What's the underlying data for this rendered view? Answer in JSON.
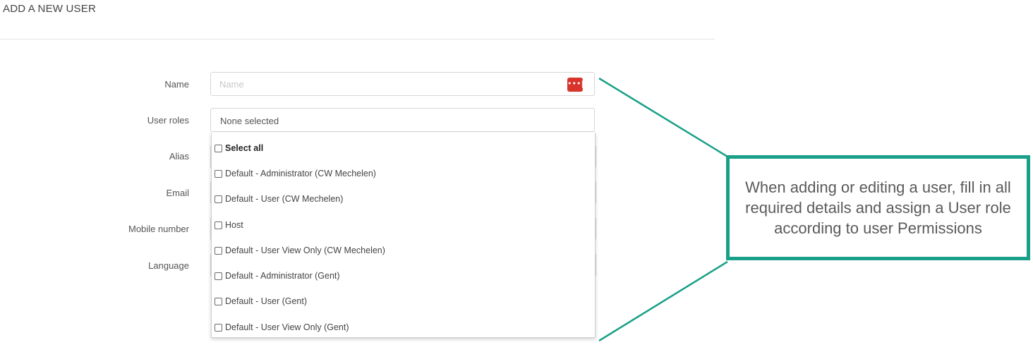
{
  "page": {
    "title": "ADD A NEW USER"
  },
  "form": {
    "name": {
      "label": "Name",
      "placeholder": "Name",
      "password_manager_icon": "password-manager-icon"
    },
    "user_roles": {
      "label": "User roles",
      "value": "None selected"
    },
    "alias": {
      "label": "Alias"
    },
    "email": {
      "label": "Email"
    },
    "mobile": {
      "label": "Mobile number"
    },
    "language": {
      "label": "Language"
    }
  },
  "dropdown": {
    "options": [
      {
        "label": "Select all",
        "checked": false,
        "bold": true
      },
      {
        "label": "Default - Administrator (CW Mechelen)",
        "checked": false
      },
      {
        "label": "Default - User (CW Mechelen)",
        "checked": false
      },
      {
        "label": "Host",
        "checked": false
      },
      {
        "label": "Default - User View Only (CW Mechelen)",
        "checked": false
      },
      {
        "label": "Default - Administrator (Gent)",
        "checked": false
      },
      {
        "label": "Default - User (Gent)",
        "checked": false
      },
      {
        "label": "Default - User View Only (Gent)",
        "checked": false
      }
    ]
  },
  "callout": {
    "text": "When adding or editing a user, fill in all required details and assign a User role according to user Permissions",
    "color": "#1aa089"
  }
}
